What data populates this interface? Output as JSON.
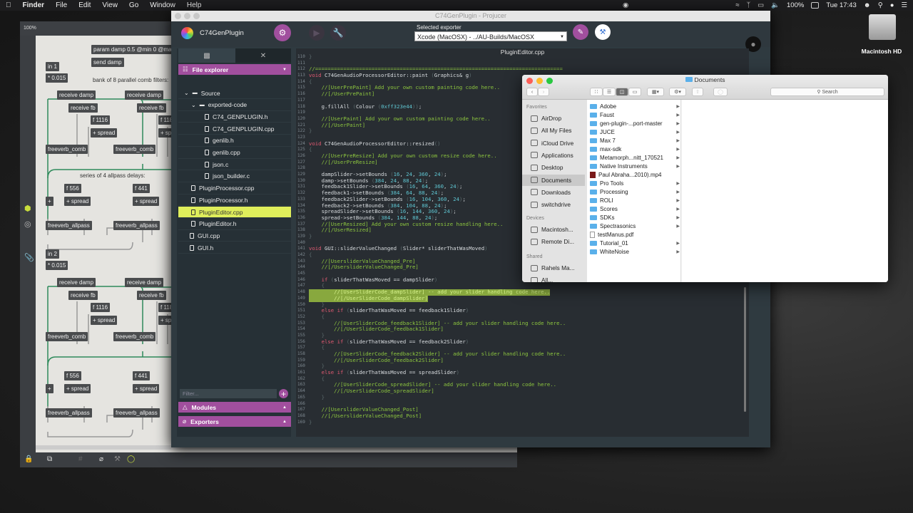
{
  "menubar": {
    "items": [
      "Finder",
      "File",
      "Edit",
      "View",
      "Go",
      "Window",
      "Help"
    ],
    "battery": "100%",
    "clock": "Tue 17:43"
  },
  "desktop": {
    "drive_label": "Macintosh HD"
  },
  "max": {
    "zoom": "100%",
    "patch_top": [
      "param damp 0.5 @min 0 @ma",
      "send damp",
      "in 1",
      "* 0.015",
      "bank of 8 parallel comb filters:",
      "receive damp",
      "receive fb",
      "f 1116",
      "+ spread",
      "freeverb_comb",
      "receive damp",
      "receive fb",
      "f 118",
      "+ sp",
      "freeverb_comb",
      "series of 4 allpass delays:",
      "f 556",
      "+",
      "+ spread",
      "freeverb_allpass",
      "f 441",
      "+ spread",
      "freeverb_allpass"
    ],
    "patch_bottom": [
      "in 2",
      "* 0.015",
      "receive damp",
      "receive fb",
      "f 1116",
      "+ spread",
      "freeverb_comb",
      "receive damp",
      "receive fb",
      "f 118",
      "+ sp",
      "freeverb_comb",
      "f 556",
      "+",
      "+ spread",
      "freeverb_allpass",
      "f 441",
      "+ spread",
      "freeverb_allpass"
    ]
  },
  "projucer": {
    "window_title": "C74GenPlugin - Projucer",
    "project_name": "C74GenPlugin",
    "exporter_label": "Selected exporter",
    "exporter_value": "Xcode (MacOSX) - ../AU-Builds/MacOSX",
    "file_explorer": "File explorer",
    "modules": "Modules",
    "exporters": "Exporters",
    "filter_placeholder": "Filter...",
    "tree": [
      {
        "label": "Source",
        "lvl": 0,
        "type": "group"
      },
      {
        "label": "exported-code",
        "lvl": 1,
        "type": "group"
      },
      {
        "label": "C74_GENPLUGIN.h",
        "lvl": 2
      },
      {
        "label": "C74_GENPLUGIN.cpp",
        "lvl": 2
      },
      {
        "label": "genlib.h",
        "lvl": 2
      },
      {
        "label": "genlib.cpp",
        "lvl": 2
      },
      {
        "label": "json.c",
        "lvl": 2
      },
      {
        "label": "json_builder.c",
        "lvl": 2
      },
      {
        "label": "PluginProcessor.cpp",
        "lvl": 1
      },
      {
        "label": "PluginProcessor.h",
        "lvl": 1
      },
      {
        "label": "PluginEditor.cpp",
        "lvl": 1,
        "selected": true
      },
      {
        "label": "PluginEditor.h",
        "lvl": 1
      },
      {
        "label": "GUI.cpp",
        "lvl": 0
      },
      {
        "label": "GUI.h",
        "lvl": 0
      }
    ],
    "editor_file": "PluginEditor.cpp",
    "code": [
      [
        "110",
        "}"
      ],
      [
        "111",
        ""
      ],
      [
        "112",
        "//==============================================================================="
      ],
      [
        "113",
        "void C74GenAudioProcessorEditor::paint (Graphics& g)"
      ],
      [
        "114",
        "{"
      ],
      [
        "115",
        "    //[UserPrePaint] Add your own custom painting code here.."
      ],
      [
        "116",
        "    //[/UserPrePaint]"
      ],
      [
        "117",
        ""
      ],
      [
        "118",
        "    g.fillAll (Colour (0xff323e44));"
      ],
      [
        "119",
        ""
      ],
      [
        "120",
        "    //[UserPaint] Add your own custom painting code here.."
      ],
      [
        "121",
        "    //[/UserPaint]"
      ],
      [
        "122",
        "}"
      ],
      [
        "123",
        ""
      ],
      [
        "124",
        "void C74GenAudioProcessorEditor::resized()"
      ],
      [
        "125",
        "{"
      ],
      [
        "126",
        "    //[UserPreResize] Add your own custom resize code here.."
      ],
      [
        "127",
        "    //[/UserPreResize]"
      ],
      [
        "128",
        ""
      ],
      [
        "129",
        "    dampSlider->setBounds (16, 24, 360, 24);"
      ],
      [
        "130",
        "    damp->setBounds (384, 24, 88, 24);"
      ],
      [
        "131",
        "    feedback1Slider->setBounds (16, 64, 360, 24);"
      ],
      [
        "132",
        "    feedback1->setBounds (384, 64, 88, 24);"
      ],
      [
        "133",
        "    feedback2Slider->setBounds (16, 104, 360, 24);"
      ],
      [
        "134",
        "    feedback2->setBounds (384, 104, 88, 24);"
      ],
      [
        "135",
        "    spreadSlider->setBounds (16, 144, 360, 24);"
      ],
      [
        "136",
        "    spread->setBounds (384, 144, 88, 24);"
      ],
      [
        "137",
        "    //[UserResized] Add your own custom resize handling here.."
      ],
      [
        "138",
        "    //[/UserResized]"
      ],
      [
        "139",
        "}"
      ],
      [
        "140",
        ""
      ],
      [
        "141",
        "void GUI::sliderValueChanged (Slider* sliderThatWasMoved)"
      ],
      [
        "142",
        "{"
      ],
      [
        "143",
        "    //[UsersliderValueChanged_Pre]"
      ],
      [
        "144",
        "    //[/UsersliderValueChanged_Pre]"
      ],
      [
        "145",
        ""
      ],
      [
        "146",
        "    if (sliderThatWasMoved == dampSlider)"
      ],
      [
        "147",
        "    {"
      ],
      [
        "148",
        "        //[UserSliderCode_dampSlider] -- add your slider handling code here.."
      ],
      [
        "149",
        "        //[/UserSliderCode_dampSlider]"
      ],
      [
        "150",
        "    }"
      ],
      [
        "151",
        "    else if (sliderThatWasMoved == feedback1Slider)"
      ],
      [
        "152",
        "    {"
      ],
      [
        "153",
        "        //[UserSliderCode_feedback1Slider] -- add your slider handling code here.."
      ],
      [
        "154",
        "        //[/UserSliderCode_feedback1Slider]"
      ],
      [
        "155",
        "    }"
      ],
      [
        "156",
        "    else if (sliderThatWasMoved == feedback2Slider)"
      ],
      [
        "157",
        "    {"
      ],
      [
        "158",
        "        //[UserSliderCode_feedback2Slider] -- add your slider handling code here.."
      ],
      [
        "159",
        "        //[/UserSliderCode_feedback2Slider]"
      ],
      [
        "160",
        "    }"
      ],
      [
        "161",
        "    else if (sliderThatWasMoved == spreadSlider)"
      ],
      [
        "162",
        "    {"
      ],
      [
        "163",
        "        //[UserSliderCode_spreadSlider] -- add your slider handling code here.."
      ],
      [
        "164",
        "        //[/UserSliderCode_spreadSlider]"
      ],
      [
        "165",
        "    }"
      ],
      [
        "166",
        ""
      ],
      [
        "167",
        "    //[UsersliderValueChanged_Post]"
      ],
      [
        "168",
        "    //[/UsersliderValueChanged_Post]"
      ],
      [
        "169",
        "}"
      ]
    ],
    "highlighted_lines": [
      "148",
      "149"
    ]
  },
  "finder": {
    "title": "Documents",
    "search_placeholder": "Search",
    "favorites_label": "Favorites",
    "devices_label": "Devices",
    "shared_label": "Shared",
    "favorites": [
      "AirDrop",
      "All My Files",
      "iCloud Drive",
      "Applications",
      "Desktop",
      "Documents",
      "Downloads",
      "switchdrive"
    ],
    "selected": "Documents",
    "devices": [
      "Macintosh...",
      "Remote Di..."
    ],
    "shared": [
      "Rahels Ma...",
      "All..."
    ],
    "files": [
      {
        "name": "Adobe",
        "type": "folder"
      },
      {
        "name": "Faust",
        "type": "folder"
      },
      {
        "name": "gen-plugin-...port-master",
        "type": "folder"
      },
      {
        "name": "JUCE",
        "type": "folder"
      },
      {
        "name": "Max 7",
        "type": "folder"
      },
      {
        "name": "max-sdk",
        "type": "folder"
      },
      {
        "name": "Metamorph...nitt_170521",
        "type": "folder"
      },
      {
        "name": "Native Instruments",
        "type": "folder"
      },
      {
        "name": "Paul Abraha...2010).mp4",
        "type": "video"
      },
      {
        "name": "Pro Tools",
        "type": "folder"
      },
      {
        "name": "Processing",
        "type": "folder"
      },
      {
        "name": "ROLI",
        "type": "folder"
      },
      {
        "name": "Scores",
        "type": "folder"
      },
      {
        "name": "SDKs",
        "type": "folder"
      },
      {
        "name": "Spectrasonics",
        "type": "folder"
      },
      {
        "name": "testManus.pdf",
        "type": "pdf"
      },
      {
        "name": "Tutorial_01",
        "type": "folder"
      },
      {
        "name": "WhiteNoise",
        "type": "folder"
      }
    ]
  },
  "colors": {
    "accent": "#a14f9e",
    "selection": "#dfee5b",
    "code_bg": "#282d32"
  }
}
